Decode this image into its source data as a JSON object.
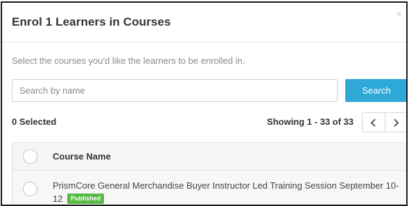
{
  "modal": {
    "title": "Enrol 1 Learners in Courses",
    "close_icon": "×",
    "instructions": "Select the courses you'd like the learners to be enrolled in."
  },
  "search": {
    "placeholder": "Search by name",
    "value": "",
    "button_label": "Search",
    "button_color": "#2ea8d6"
  },
  "status": {
    "selected_label": "0 Selected",
    "showing_label": "Showing 1 - 33 of 33"
  },
  "pagination": {
    "prev_icon": "chevron-left-icon",
    "next_icon": "chevron-right-icon"
  },
  "table": {
    "column_header": "Course Name",
    "rows": [
      {
        "name": "PrismCore General Merchandise Buyer Instructor Led Training Session September 10-12",
        "badge": "Published",
        "badge_color": "#58b845",
        "selected": false
      }
    ]
  }
}
